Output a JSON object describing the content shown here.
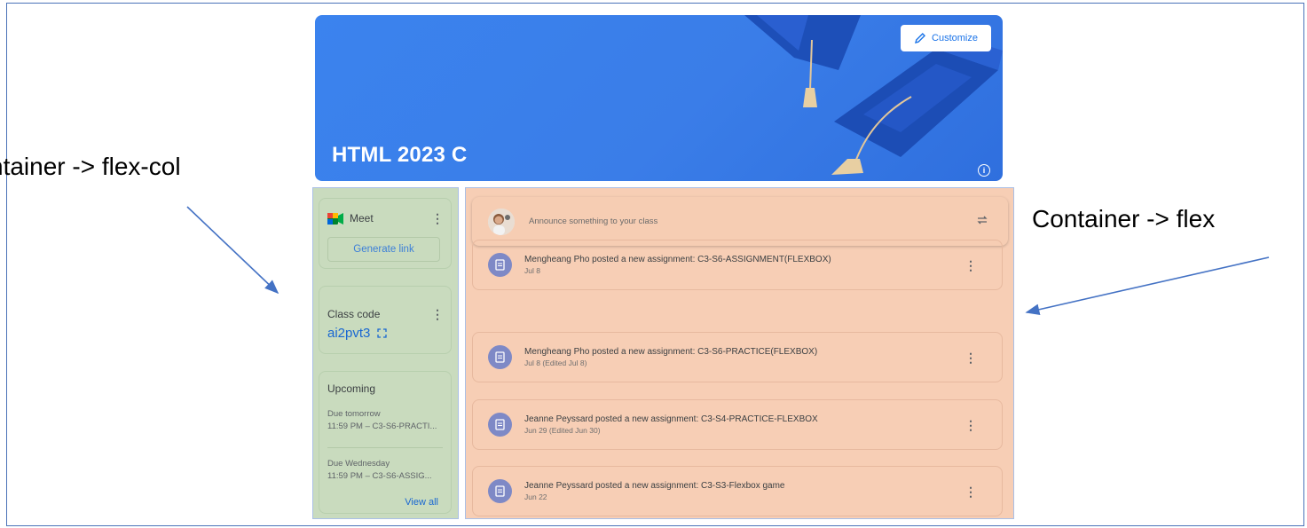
{
  "annotations": {
    "left_label": "ntainer -> flex-col",
    "right_label": "Container -> flex"
  },
  "banner": {
    "class_name": "HTML 2023 C",
    "customize_label": "Customize",
    "info_glyph": "i",
    "color": "#3b83ee"
  },
  "sidebar": {
    "meet": {
      "label": "Meet",
      "button_label": "Generate link"
    },
    "class_code": {
      "label": "Class code",
      "value": "ai2pvt3"
    },
    "upcoming": {
      "title": "Upcoming",
      "items": [
        {
          "due": "Due tomorrow",
          "text": "11:59 PM – C3-S6-PRACTI..."
        },
        {
          "due": "Due Wednesday",
          "text": "11:59 PM – C3-S6-ASSIG..."
        }
      ],
      "view_all_label": "View all"
    },
    "background": "#c9dbbe"
  },
  "stream": {
    "announce_placeholder": "Announce something to your class",
    "background": "#f7ceb5",
    "posts": [
      {
        "title": "Mengheang Pho posted a new assignment: C3-S6-ASSIGNMENT(FLEXBOX)",
        "date": "Jul 8"
      },
      {
        "title": "Mengheang Pho posted a new assignment: C3-S6-PRACTICE(FLEXBOX)",
        "date": "Jul 8 (Edited Jul 8)"
      },
      {
        "title": "Jeanne Peyssard posted a new assignment: C3-S4-PRACTICE-FLEXBOX",
        "date": "Jun 29 (Edited Jun 30)"
      },
      {
        "title": "Jeanne Peyssard posted a new assignment: C3-S3-Flexbox game",
        "date": "Jun 22"
      }
    ]
  },
  "icons": {
    "customize": "pencil-icon",
    "info": "info-icon",
    "meet": "google-meet-icon",
    "more": "more-vert-icon",
    "fullscreen": "fullscreen-icon",
    "repost": "repost-icon",
    "assignment": "assignment-icon"
  }
}
